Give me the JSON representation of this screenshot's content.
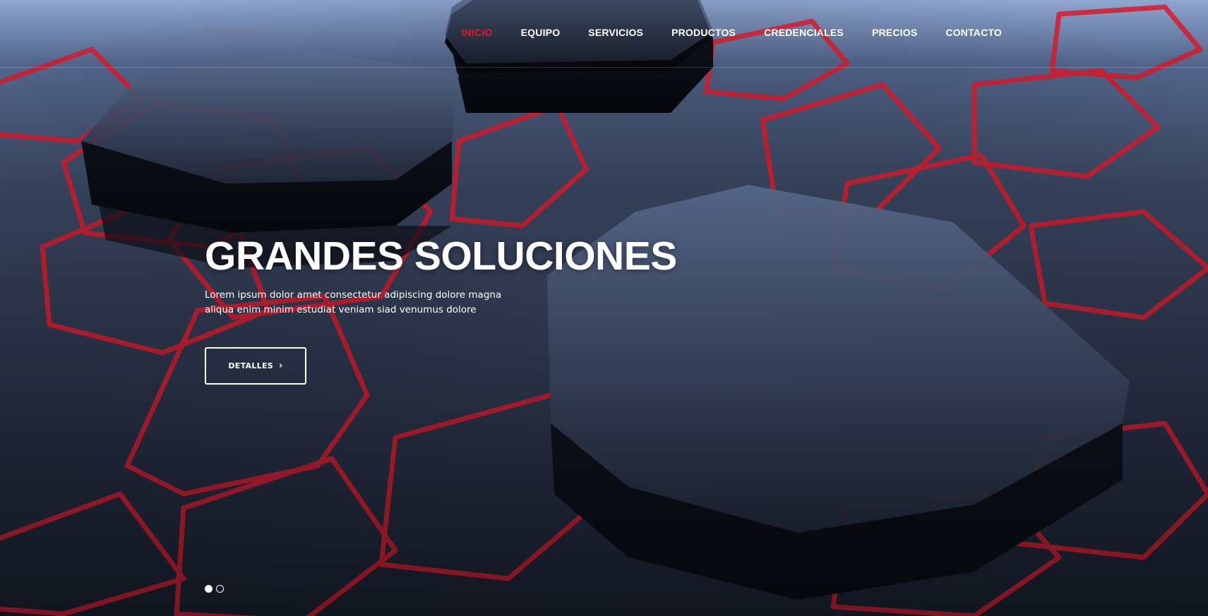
{
  "brand": {
    "name": "Tu Empresa"
  },
  "nav": {
    "items": [
      {
        "label": "INICIO",
        "active": true
      },
      {
        "label": "EQUIPO",
        "active": false
      },
      {
        "label": "SERVICIOS",
        "active": false
      },
      {
        "label": "PRODUCTOS",
        "active": false
      },
      {
        "label": "CREDENCIALES",
        "active": false
      },
      {
        "label": "PRECIOS",
        "active": false
      },
      {
        "label": "CONTACTO",
        "active": false
      }
    ]
  },
  "hero": {
    "headline": "GRANDES SOLUCIONES",
    "subtitle": "Lorem ipsum dolor amet consectetur adipiscing dolore magna aliqua enim minim estudiat veniam siad venumus dolore",
    "button_label": "DETALLES",
    "button_icon": "chevron-right-icon",
    "slide_count": 2,
    "active_slide": 1
  },
  "colors": {
    "accent": "#e5162a",
    "text": "#ffffff",
    "brand_text": "#6f7a8c"
  }
}
